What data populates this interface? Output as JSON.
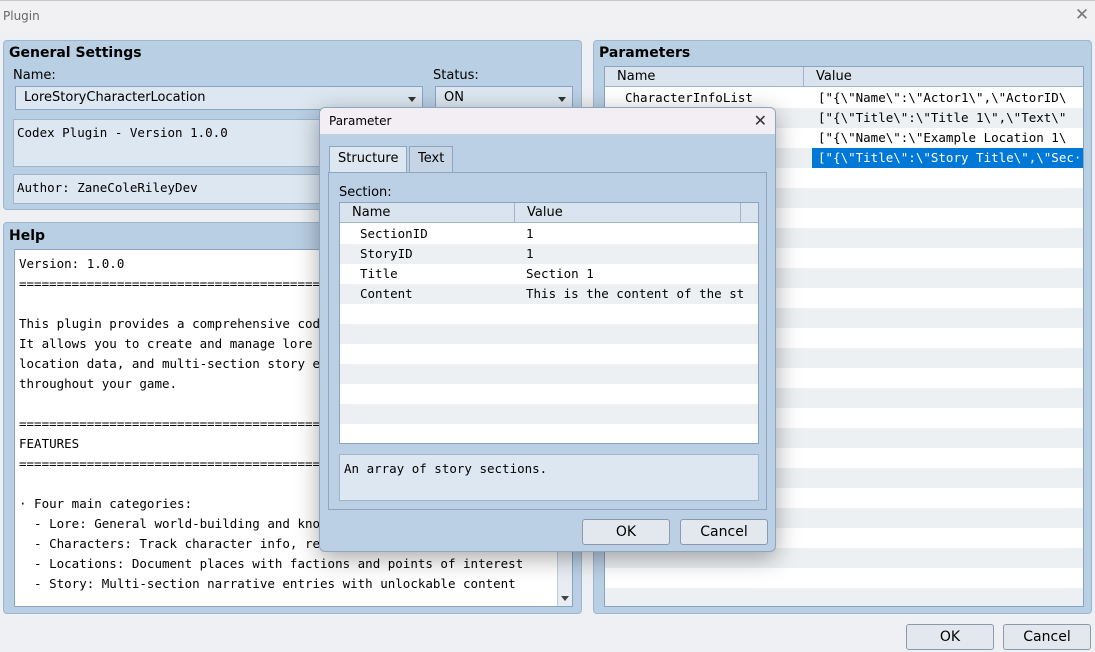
{
  "window": {
    "title": "Plugin",
    "close_glyph": "✕"
  },
  "general": {
    "title": "General Settings",
    "name_label": "Name:",
    "name_value": "LoreStoryCharacterLocation",
    "status_label": "Status:",
    "status_value": "ON",
    "description": "Codex Plugin - Version 1.0.0",
    "author": "Author: ZaneColeRileyDev"
  },
  "help": {
    "title": "Help",
    "lines": [
      "Version: 1.0.0",
      "==============================================",
      "",
      "This plugin provides a comprehensive codex/j",
      "It allows you to create and manage lore entr",
      "location data, and multi-section story entri",
      "throughout your game.",
      "",
      "==============================================",
      "FEATURES",
      "==============================================",
      "",
      "· Four main categories:",
      "  - Lore: General world-building and knowled",
      "  - Characters: Track character info, relati",
      "  - Locations: Document places with factions and points of interest",
      "  - Story: Multi-section narrative entries with unlockable content"
    ]
  },
  "parameters": {
    "title": "Parameters",
    "col_name": "Name",
    "col_value": "Value",
    "rows": [
      {
        "name": "CharacterInfoList",
        "value": "[\"{\\\"Name\\\":\\\"Actor1\\\",\\\"ActorID\\\"···"
      },
      {
        "name": "",
        "value": "[\"{\\\"Title\\\":\\\"Title 1\\\",\\\"Text\\\":···"
      },
      {
        "name": "",
        "value": "[\"{\\\"Name\\\":\\\"Example Location 1\\\"···"
      },
      {
        "name": "",
        "value": "[\"{\\\"Title\\\":\\\"Story Title\\\",\\\"Sec···"
      }
    ]
  },
  "footer": {
    "ok": "OK",
    "cancel": "Cancel"
  },
  "modal": {
    "title": "Parameter",
    "close_glyph": "✕",
    "tabs": [
      "Structure",
      "Text"
    ],
    "section_label": "Section:",
    "col_name": "Name",
    "col_value": "Value",
    "rows": [
      {
        "name": "SectionID",
        "value": "1"
      },
      {
        "name": "StoryID",
        "value": "1"
      },
      {
        "name": "Title",
        "value": "Section 1"
      },
      {
        "name": "Content",
        "value": "This is the content of the st···"
      }
    ],
    "description": "An array of story sections.",
    "ok": "OK",
    "cancel": "Cancel"
  },
  "colors": {
    "panel": "#b9cfe4",
    "selection": "#0078d7"
  }
}
